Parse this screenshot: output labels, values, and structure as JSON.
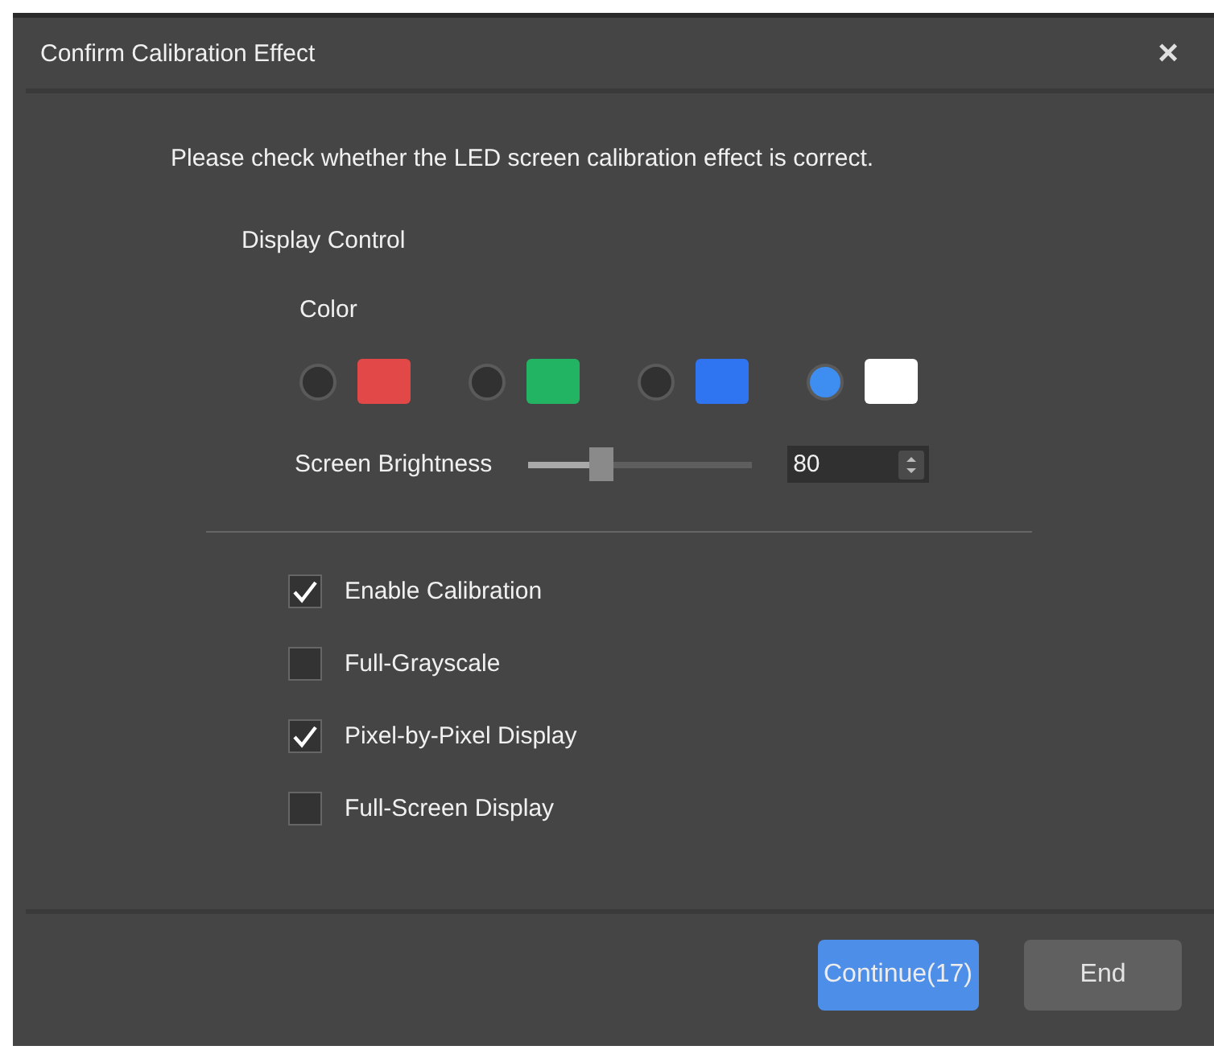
{
  "window": {
    "title": "Confirm Calibration Effect",
    "close": "×"
  },
  "message": "Please check whether the LED screen calibration effect is correct.",
  "display_control": {
    "label": "Display Control",
    "color_label": "Color",
    "colors": [
      {
        "color": "#e24848",
        "selected": false
      },
      {
        "color": "#22b463",
        "selected": false
      },
      {
        "color": "#2f74f0",
        "selected": false
      },
      {
        "color": "#ffffff",
        "selected": true
      }
    ],
    "brightness": {
      "label": "Screen Brightness",
      "level": 0.33,
      "value": "80"
    }
  },
  "options": [
    {
      "label": "Enable Calibration",
      "checked": true
    },
    {
      "label": "Full-Grayscale",
      "checked": false
    },
    {
      "label": "Pixel-by-Pixel Display",
      "checked": true
    },
    {
      "label": "Full-Screen Display",
      "checked": false
    }
  ],
  "buttons": [
    {
      "label": "Continue(17)",
      "kind": "primary"
    },
    {
      "label": "End",
      "kind": "secondary"
    }
  ]
}
